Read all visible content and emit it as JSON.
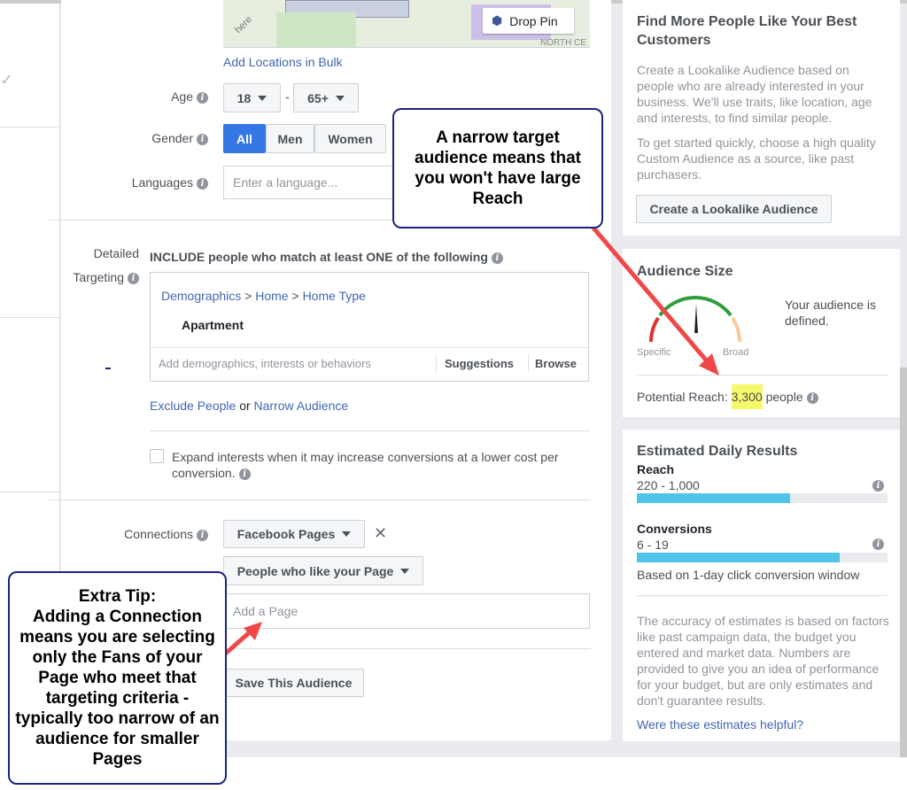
{
  "map": {
    "drop_pin": "Drop Pin",
    "label": "NORTH CE",
    "watermark": "here"
  },
  "location": {
    "bulk_link": "Add Locations in Bulk"
  },
  "age": {
    "label": "Age",
    "min": "18",
    "max": "65+",
    "sep": "-"
  },
  "gender": {
    "label": "Gender",
    "options": [
      "All",
      "Men",
      "Women"
    ],
    "selected": "All"
  },
  "languages": {
    "label": "Languages",
    "placeholder": "Enter a language..."
  },
  "detailed": {
    "label1": "Detailed",
    "label2": "Targeting",
    "include_text": "INCLUDE people who match at least ONE of the following",
    "breadcrumb": [
      "Demographics",
      "Home",
      "Home Type"
    ],
    "sep": ">",
    "item": "Apartment",
    "placeholder": "Add demographics, interests or behaviors",
    "suggestions": "Suggestions",
    "browse": "Browse",
    "exclude": "Exclude People",
    "or": "or",
    "narrow": "Narrow Audience",
    "expand_text": "Expand interests when it may increase conversions at a lower cost per conversion."
  },
  "connections": {
    "label": "Connections",
    "type": "Facebook Pages",
    "sub": "People who like your Page",
    "placeholder": "Add a Page",
    "save": "Save This Audience"
  },
  "lookalike": {
    "title": "Find More People Like Your Best Customers",
    "p1": "Create a Lookalike Audience based on people who are already interested in your business. We'll use traits, like location, age and interests, to find similar people.",
    "p2": "To get started quickly, choose a high quality Custom Audience as a source, like past purchasers.",
    "button": "Create a Lookalike Audience"
  },
  "audience": {
    "title": "Audience Size",
    "status": "Your audience is defined.",
    "specific": "Specific",
    "broad": "Broad",
    "reach_label": "Potential Reach:",
    "reach_value": "3,300",
    "reach_unit": "people",
    "highlight_color": "#f4fa6b"
  },
  "estimates": {
    "title": "Estimated Daily Results",
    "reach_label": "Reach",
    "reach_range": "220 - 1,000",
    "reach_fill": 0.61,
    "conv_label": "Conversions",
    "conv_range": "6 - 19",
    "conv_fill": 0.81,
    "window": "Based on 1-day click conversion window",
    "disclaimer": "The accuracy of estimates is based on factors like past campaign data, the budget you entered and market data. Numbers are provided to give you an idea of performance for your budget, but are only estimates and don't guarantee results.",
    "helpful": "Were these estimates helpful?"
  },
  "callouts": {
    "top": "A narrow target audience means that you won't have large Reach",
    "tip": "Extra Tip:\nAdding a Connection means you are selecting only the Fans of your Page who meet that targeting criteria - typically too narrow of an audience for smaller Pages"
  },
  "colors": {
    "accent": "#4267b2",
    "selected": "#3578e5",
    "arrow": "#f04848",
    "bar": "#4fc3e8"
  }
}
